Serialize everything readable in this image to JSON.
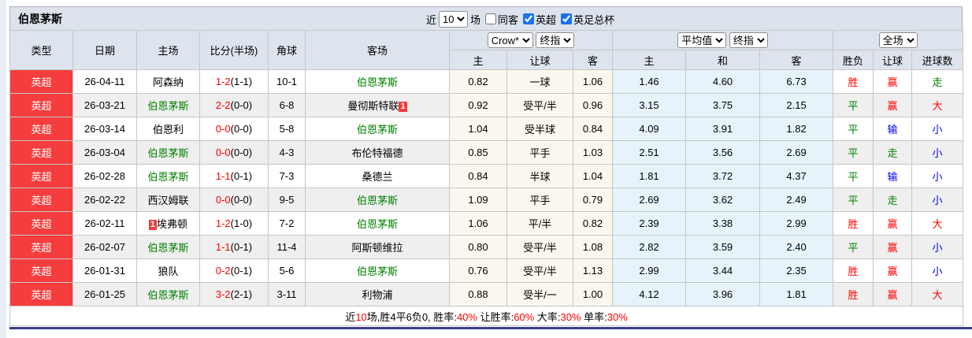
{
  "title_bar": {
    "team_name": "伯恩茅斯",
    "recent_prefix": "近",
    "recent_count": "10",
    "recent_suffix": "场",
    "filters": [
      {
        "label": "同客",
        "checked": false
      },
      {
        "label": "英超",
        "checked": true
      },
      {
        "label": "英足总杯",
        "checked": true
      }
    ]
  },
  "table": {
    "columns": {
      "type": "类型",
      "date": "日期",
      "home": "主场",
      "score": "比分(半场)",
      "corner": "角球",
      "away": "客场",
      "odds_sub": [
        "主",
        "让球",
        "客"
      ],
      "avg_sub": [
        "主",
        "和",
        "客"
      ],
      "result_sub": [
        "胜负",
        "让球",
        "进球数"
      ]
    },
    "selects": {
      "odds_company": "Crow*",
      "odds_stage": "终指",
      "avg_source": "平均值",
      "avg_stage": "终指",
      "result_scope": "全场"
    },
    "rows": [
      {
        "type": "英超",
        "date": "26-04-11",
        "home": {
          "name": "阿森纳",
          "green": false
        },
        "score": "1-2",
        "half": "(1-1)",
        "corner": "10-1",
        "away": {
          "name": "伯恩茅斯",
          "green": true
        },
        "odds": [
          "0.82",
          "一球",
          "1.06"
        ],
        "avg": [
          "1.46",
          "4.60",
          "6.73"
        ],
        "results": [
          {
            "text": "胜",
            "color": "red"
          },
          {
            "text": "赢",
            "color": "red"
          },
          {
            "text": "走",
            "color": "green"
          }
        ]
      },
      {
        "type": "英超",
        "date": "26-03-21",
        "home": {
          "name": "伯恩茅斯",
          "green": true
        },
        "score": "2-2",
        "half": "(0-0)",
        "corner": "6-8",
        "away": {
          "name": "曼彻斯特联",
          "green": false,
          "badge": "1",
          "badge_pos": "after"
        },
        "odds": [
          "0.92",
          "受平/半",
          "0.96"
        ],
        "avg": [
          "3.15",
          "3.75",
          "2.15"
        ],
        "results": [
          {
            "text": "平",
            "color": "green"
          },
          {
            "text": "赢",
            "color": "red"
          },
          {
            "text": "大",
            "color": "red"
          }
        ]
      },
      {
        "type": "英超",
        "date": "26-03-14",
        "home": {
          "name": "伯恩利",
          "green": false
        },
        "score": "0-0",
        "half": "(0-0)",
        "corner": "5-8",
        "away": {
          "name": "伯恩茅斯",
          "green": true
        },
        "odds": [
          "1.04",
          "受半球",
          "0.84"
        ],
        "avg": [
          "4.09",
          "3.91",
          "1.82"
        ],
        "results": [
          {
            "text": "平",
            "color": "green"
          },
          {
            "text": "输",
            "color": "blue"
          },
          {
            "text": "小",
            "color": "blue"
          }
        ]
      },
      {
        "type": "英超",
        "date": "26-03-04",
        "home": {
          "name": "伯恩茅斯",
          "green": true
        },
        "score": "0-0",
        "half": "(0-0)",
        "corner": "4-3",
        "away": {
          "name": "布伦特福德",
          "green": false
        },
        "odds": [
          "0.85",
          "平手",
          "1.03"
        ],
        "avg": [
          "2.51",
          "3.56",
          "2.69"
        ],
        "results": [
          {
            "text": "平",
            "color": "green"
          },
          {
            "text": "走",
            "color": "green"
          },
          {
            "text": "小",
            "color": "blue"
          }
        ]
      },
      {
        "type": "英超",
        "date": "26-02-28",
        "home": {
          "name": "伯恩茅斯",
          "green": true
        },
        "score": "1-1",
        "half": "(0-1)",
        "corner": "7-3",
        "away": {
          "name": "桑德兰",
          "green": false
        },
        "odds": [
          "0.84",
          "半球",
          "1.04"
        ],
        "avg": [
          "1.81",
          "3.72",
          "4.37"
        ],
        "results": [
          {
            "text": "平",
            "color": "green"
          },
          {
            "text": "输",
            "color": "blue"
          },
          {
            "text": "小",
            "color": "blue"
          }
        ]
      },
      {
        "type": "英超",
        "date": "26-02-22",
        "home": {
          "name": "西汉姆联",
          "green": false
        },
        "score": "0-0",
        "half": "(0-0)",
        "corner": "9-5",
        "away": {
          "name": "伯恩茅斯",
          "green": true
        },
        "odds": [
          "1.09",
          "平手",
          "0.79"
        ],
        "avg": [
          "2.69",
          "3.62",
          "2.49"
        ],
        "results": [
          {
            "text": "平",
            "color": "green"
          },
          {
            "text": "走",
            "color": "green"
          },
          {
            "text": "小",
            "color": "blue"
          }
        ]
      },
      {
        "type": "英超",
        "date": "26-02-11",
        "home": {
          "name": "埃弗顿",
          "green": false,
          "badge": "1",
          "badge_pos": "before"
        },
        "score": "1-2",
        "half": "(1-0)",
        "corner": "7-2",
        "away": {
          "name": "伯恩茅斯",
          "green": true
        },
        "odds": [
          "1.06",
          "平/半",
          "0.82"
        ],
        "avg": [
          "2.39",
          "3.38",
          "2.99"
        ],
        "results": [
          {
            "text": "胜",
            "color": "red"
          },
          {
            "text": "赢",
            "color": "red"
          },
          {
            "text": "大",
            "color": "red"
          }
        ]
      },
      {
        "type": "英超",
        "date": "26-02-07",
        "home": {
          "name": "伯恩茅斯",
          "green": true
        },
        "score": "1-1",
        "half": "(0-1)",
        "corner": "11-4",
        "away": {
          "name": "阿斯顿维拉",
          "green": false
        },
        "odds": [
          "0.80",
          "受平/半",
          "1.08"
        ],
        "avg": [
          "2.82",
          "3.59",
          "2.40"
        ],
        "results": [
          {
            "text": "平",
            "color": "green"
          },
          {
            "text": "赢",
            "color": "red"
          },
          {
            "text": "小",
            "color": "blue"
          }
        ]
      },
      {
        "type": "英超",
        "date": "26-01-31",
        "home": {
          "name": "狼队",
          "green": false
        },
        "score": "0-2",
        "half": "(0-1)",
        "corner": "5-6",
        "away": {
          "name": "伯恩茅斯",
          "green": true
        },
        "odds": [
          "0.76",
          "受平/半",
          "1.13"
        ],
        "avg": [
          "2.99",
          "3.44",
          "2.35"
        ],
        "results": [
          {
            "text": "胜",
            "color": "red"
          },
          {
            "text": "赢",
            "color": "red"
          },
          {
            "text": "小",
            "color": "blue"
          }
        ]
      },
      {
        "type": "英超",
        "date": "26-01-25",
        "home": {
          "name": "伯恩茅斯",
          "green": true
        },
        "score": "3-2",
        "half": "(2-1)",
        "corner": "3-11",
        "away": {
          "name": "利物浦",
          "green": false
        },
        "odds": [
          "0.88",
          "受半/一",
          "1.00"
        ],
        "avg": [
          "4.12",
          "3.96",
          "1.81"
        ],
        "results": [
          {
            "text": "胜",
            "color": "red"
          },
          {
            "text": "赢",
            "color": "red"
          },
          {
            "text": "大",
            "color": "red"
          }
        ]
      }
    ]
  },
  "footer": {
    "segments": [
      {
        "text": "近",
        "red": false
      },
      {
        "text": "10",
        "red": true
      },
      {
        "text": "场,胜4平6负0, 胜率:",
        "red": false
      },
      {
        "text": "40%",
        "red": true
      },
      {
        "text": " 让胜率:",
        "red": false
      },
      {
        "text": "60%",
        "red": true
      },
      {
        "text": " 大率:",
        "red": false
      },
      {
        "text": "30%",
        "red": true
      },
      {
        "text": " 单率:",
        "red": false
      },
      {
        "text": "30%",
        "red": true
      }
    ]
  },
  "colors": {
    "league_badge": "#f53d3d",
    "score": "#ff0000",
    "team_highlight": "#008000",
    "win": "#ff0000",
    "draw": "#008000",
    "lose": "#0000ee",
    "header_bg": "#dee4ee",
    "odds_bg": "#fbf7ef",
    "avg_bg": "#e7f3fa",
    "row_stripe": "#efefef",
    "bottom_bar": "#3b3b8d"
  }
}
